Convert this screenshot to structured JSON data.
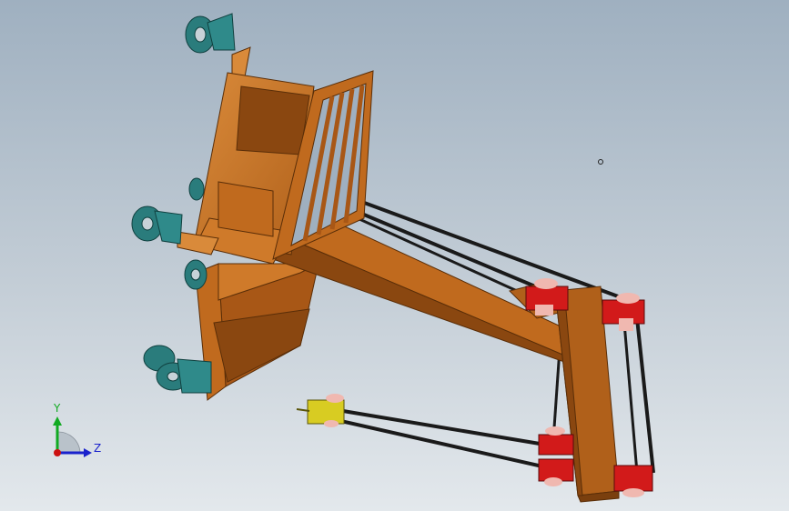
{
  "triad": {
    "y_label": "Y",
    "z_label": "Z",
    "y_color": "#11aa22",
    "z_color": "#1a22cc",
    "origin_color": "#cc1111"
  },
  "colors": {
    "background_top": "#9fb0c0",
    "background_bottom": "#e3e8ec",
    "frame_wood": "#c06a1e",
    "frame_wood_dark": "#8a4710",
    "frame_wood_light": "#d98a3a",
    "caster_teal": "#2a7c7c",
    "pulley_red": "#d21a1a",
    "pulley_yellow": "#d8cc22",
    "cable_black": "#1a1a1a"
  },
  "model": {
    "icons": [
      "caster-wheel-icon",
      "pulley-block-icon",
      "cable-icon",
      "frame-icon"
    ]
  }
}
